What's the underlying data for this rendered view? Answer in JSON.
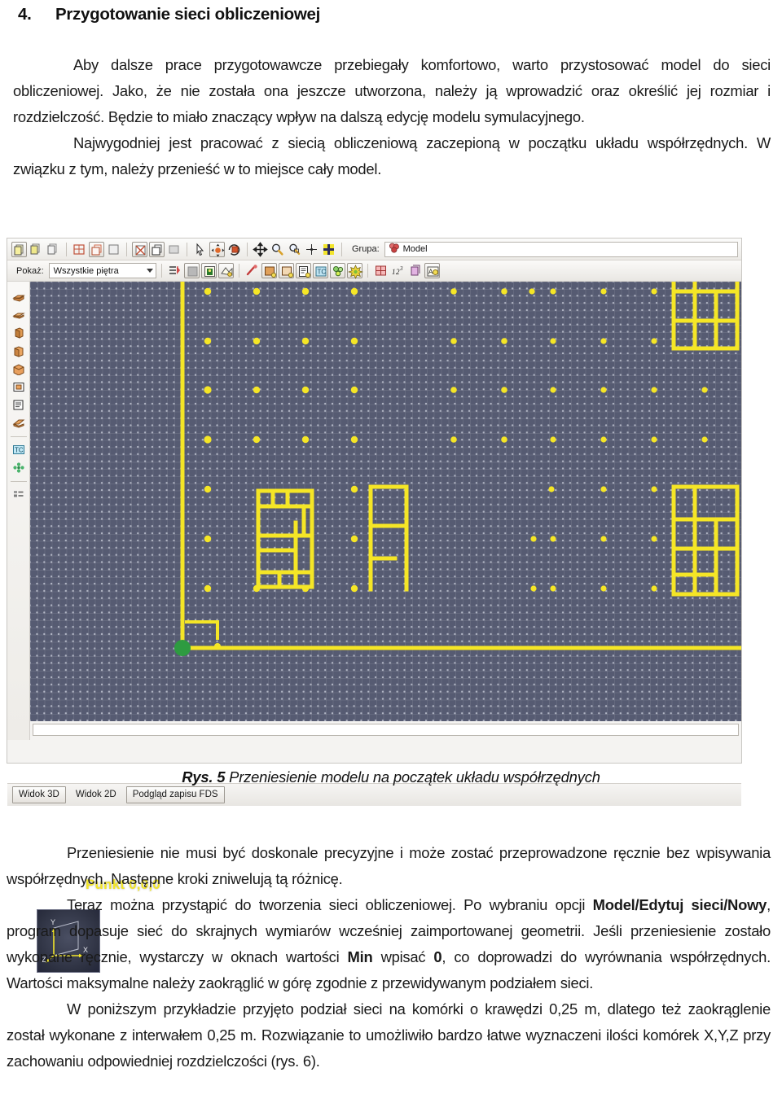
{
  "document": {
    "heading": {
      "number": "4.",
      "text": "Przygotowanie sieci obliczeniowej"
    },
    "paragraphs_top": [
      "Aby dalsze prace przygotowawcze przebiegały komfortowo, warto przystosować model do sieci obliczeniowej. Jako, że nie została ona jeszcze utworzona, należy ją wprowadzić oraz określić jej rozmiar i rozdzielczość. Będzie to miało znaczący wpływ na dalszą edycję modelu symulacyjnego.",
      "Najwygodniej jest pracować z siecią obliczeniową zaczepioną w początku układu współrzędnych. W związku z tym, należy przenieść w to miejsce cały model."
    ],
    "figure_caption": {
      "label": "Rys. 5",
      "text": "Przeniesienie modelu na początek układu współrzędnych"
    },
    "paragraphs_bottom": [
      {
        "runs": [
          {
            "text": "Przeniesienie nie musi być doskonale precyzyjne i może zostać przeprowadzone ręcznie bez wpisywania współrzędnych. Następne kroki zniwelują tą różnicę.",
            "bold": false
          }
        ]
      },
      {
        "runs": [
          {
            "text": "Teraz można przystąpić do tworzenia sieci obliczeniowej. Po wybraniu opcji ",
            "bold": false
          },
          {
            "text": "Model/Edytuj sieci/Nowy",
            "bold": true
          },
          {
            "text": ", program dopasuje sieć do skrajnych wymiarów wcześniej zaimportowanej geometrii. Jeśli przeniesienie zostało wykonane ręcznie, wystarczy w oknach wartości ",
            "bold": false
          },
          {
            "text": "Min",
            "bold": true
          },
          {
            "text": " wpisać ",
            "bold": false
          },
          {
            "text": "0",
            "bold": true
          },
          {
            "text": ", co doprowadzi do wyrównania współrzędnych. Wartości maksymalne należy zaokrąglić w górę zgodnie z przewidywanym podziałem sieci.",
            "bold": false
          }
        ]
      },
      {
        "runs": [
          {
            "text": "W poniższym przykładzie przyjęto podział sieci na komórki o krawędzi 0,25 m, dlatego też zaokrąglenie został wykonane z interwałem 0,25 m. Rozwiązanie to umożliwiło bardzo łatwe wyznaczeni ilości komórek X,Y,Z przy zachowaniu odpowiedniej rozdzielczości (rys. 6).",
            "bold": false
          }
        ]
      }
    ]
  },
  "app": {
    "toolbar_row1": {
      "groups": [
        {
          "items": [
            {
              "name": "copy-faces-icon",
              "label": "",
              "pressed": true
            },
            {
              "name": "copy-object-icon",
              "label": "",
              "pressed": false
            },
            {
              "name": "paste-object-icon",
              "label": "",
              "pressed": false
            }
          ]
        },
        {
          "items": [
            {
              "name": "wireframe-view-icon",
              "label": "",
              "pressed": false
            },
            {
              "name": "hidden-line-view-icon",
              "label": "",
              "pressed": true
            },
            {
              "name": "shaded-textured-view-icon",
              "label": "",
              "pressed": false
            }
          ]
        },
        {
          "items": [
            {
              "name": "transparent-view-icon",
              "label": "",
              "pressed": true
            },
            {
              "name": "solid-view-icon",
              "label": "",
              "pressed": true
            },
            {
              "name": "flat-view-icon",
              "label": "",
              "pressed": false
            }
          ]
        },
        {
          "items": [
            {
              "name": "select-arrow-icon",
              "label": "",
              "pressed": false
            },
            {
              "name": "move-object-icon",
              "label": "",
              "pressed": true
            },
            {
              "name": "rotate-object-icon",
              "label": "",
              "pressed": false
            }
          ]
        },
        {
          "items": [
            {
              "name": "pan-icon",
              "label": "",
              "pressed": false
            },
            {
              "name": "zoom-icon",
              "label": "",
              "pressed": false
            },
            {
              "name": "zoom-window-icon",
              "label": "",
              "pressed": false
            },
            {
              "name": "zoom-extents-icon",
              "label": "",
              "pressed": false
            },
            {
              "name": "fit-selection-icon",
              "label": "",
              "pressed": false
            }
          ]
        }
      ],
      "group_label": "Grupa:",
      "group_value": "Model"
    },
    "toolbar_row2": {
      "show_label": "Pokaż:",
      "floor_filter_value": "Wszystkie piętra",
      "floor_filter_options": [
        "Wszystkie piętra"
      ],
      "icons": [
        {
          "name": "floor-list-icon"
        },
        {
          "name": "render-preview-icon"
        },
        {
          "name": "image-overlay-icon"
        },
        {
          "name": "dxf-import-icon"
        },
        {
          "name": "measure-tool-icon"
        },
        {
          "name": "new-obstruction-icon"
        },
        {
          "name": "new-hole-icon"
        },
        {
          "name": "new-surface-icon"
        },
        {
          "name": "text-label-icon"
        },
        {
          "name": "particles-icon"
        },
        {
          "name": "burner-icon"
        },
        {
          "name": "mesh-edit-icon"
        },
        {
          "name": "dimension-icon"
        },
        {
          "name": "copy-group-icon"
        },
        {
          "name": "annotate-icon"
        }
      ]
    },
    "left_toolbar": [
      {
        "name": "new-slab-icon"
      },
      {
        "name": "new-thin-slab-icon"
      },
      {
        "name": "new-wall-icon"
      },
      {
        "name": "new-block-icon"
      },
      {
        "name": "new-box-icon"
      },
      {
        "name": "new-frame-icon"
      },
      {
        "name": "properties-icon"
      },
      {
        "name": "new-ramp-icon"
      },
      {
        "name": "temperature-device-icon"
      },
      {
        "name": "mesh-node-icon"
      },
      {
        "name": "layer-list-icon"
      }
    ],
    "viewport": {
      "origin_label": "Punkt 0,0,0",
      "axis_labels": {
        "x": "X",
        "y": "Y",
        "z": "Z"
      },
      "background_color": "#565b72",
      "geometry_color": "#f5e626",
      "origin_marker_color": "#2e9b41"
    },
    "tabs": [
      {
        "label": "Widok 3D",
        "selected": true
      },
      {
        "label": "Widok 2D",
        "selected": false
      },
      {
        "label": "Podgląd zapisu FDS",
        "selected": true
      }
    ]
  }
}
